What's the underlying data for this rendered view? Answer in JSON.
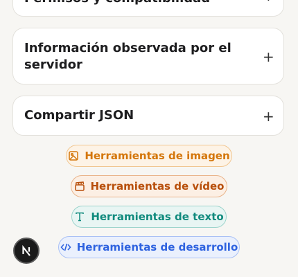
{
  "accordion": [
    {
      "title": "Permisos y compatibilidad",
      "toggle": "+"
    },
    {
      "title": "Información observada por el servidor",
      "toggle": "+"
    },
    {
      "title": "Compartir JSON",
      "toggle": "+"
    }
  ],
  "tools": {
    "image": {
      "label": "Herramientas de imagen",
      "icon": "image-icon",
      "color": "#d4760a"
    },
    "video": {
      "label": "Herramientas de vídeo",
      "icon": "clapperboard-icon",
      "color": "#b84f0b"
    },
    "text": {
      "label": "Herramientas de texto",
      "icon": "text-type-icon",
      "color": "#0f8a7d"
    },
    "dev": {
      "label": "Herramientas de desarrollo",
      "icon": "code-icon",
      "color": "#2f63e0"
    }
  },
  "badge": {
    "icon": "nextjs-logo-icon"
  }
}
